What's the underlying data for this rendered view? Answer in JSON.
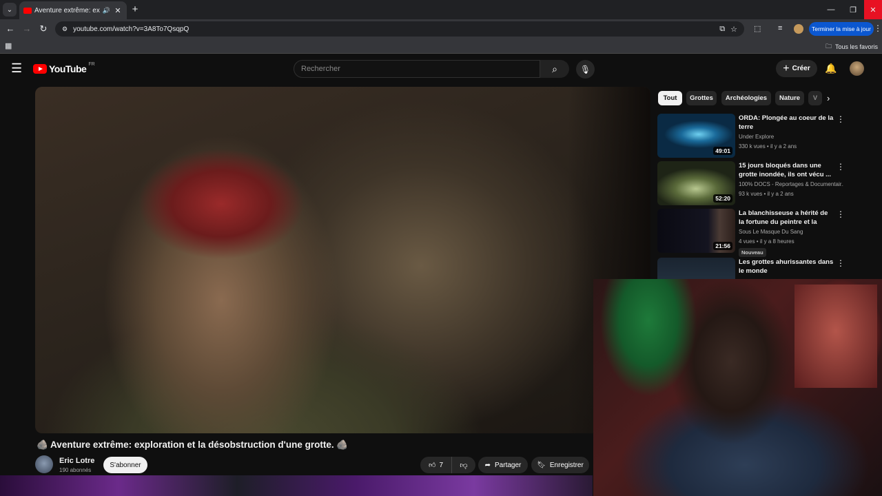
{
  "browser": {
    "tab_title": "Aventure extrême: exploration",
    "tab_close": "✕",
    "new_tab": "+",
    "url": "youtube.com/watch?v=3A8To7QsqpQ",
    "update_button": "Terminer la mise à jour",
    "bookmarks_folder": "Tous les favoris",
    "window_minimize": "—",
    "window_restore": "❐",
    "window_close": "✕"
  },
  "header": {
    "logo_text": "YouTube",
    "region": "FR",
    "search_placeholder": "Rechercher",
    "create_label": "Créer"
  },
  "video": {
    "title": "🪨 Aventure extrême: exploration et la désobstruction d'une grotte. 🪨",
    "channel": "Eric Lotre",
    "subscribers": "190 abonnés",
    "subscribe_label": "S'abonner",
    "likes": "7",
    "share_label": "Partager",
    "save_label": "Enregistrer"
  },
  "chips": [
    "Tout",
    "Grottes",
    "Archéologies",
    "Nature",
    "V"
  ],
  "recommendations": [
    {
      "title": "ORDA: Plongée au coeur de la terre",
      "channel": "Under Explore",
      "meta": "330 k vues • il y a 2 ans",
      "duration": "49:01",
      "badge": ""
    },
    {
      "title": "15 jours bloqués dans une grotte inondée, ils ont vécu ...",
      "channel": "100% DOCS - Reportages & Documentair...",
      "meta": "93 k vues • il y a 2 ans",
      "duration": "52:20",
      "badge": ""
    },
    {
      "title": "La blanchisseuse a hérité de la fortune du peintre et la famille...",
      "channel": "Sous Le Masque Du Sang",
      "meta": "4 vues • il y a 8 heures",
      "duration": "21:56",
      "badge": "Nouveau"
    },
    {
      "title": "Les grottes ahurissantes dans le monde",
      "channel": "",
      "meta": "",
      "duration": "",
      "badge": ""
    }
  ],
  "colors": {
    "yt_red": "#ff0000",
    "update_blue": "#0b57d0",
    "background": "#0f0f0f"
  }
}
